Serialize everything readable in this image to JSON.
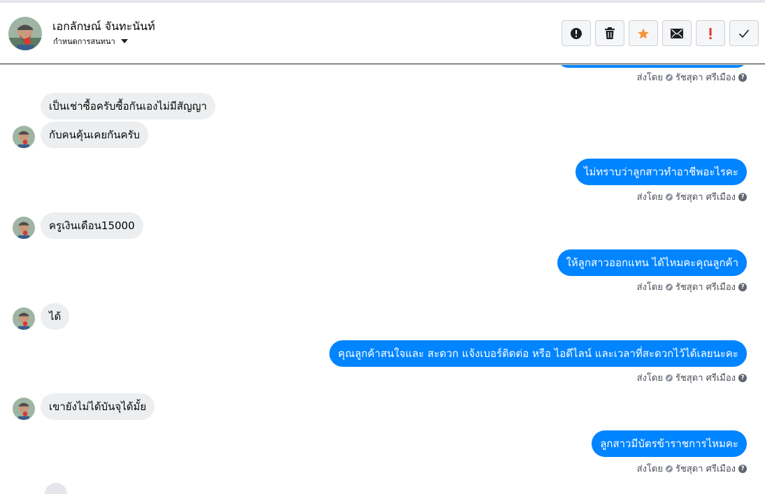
{
  "header": {
    "contact_name": "เอกลักษณ์ จันทะนันท์",
    "thread_setting_label": "กำหนดการสนทนา",
    "toolbar": [
      {
        "name": "report-button",
        "icon": "alert-circle-icon"
      },
      {
        "name": "delete-button",
        "icon": "trash-icon"
      },
      {
        "name": "star-button",
        "icon": "star-icon"
      },
      {
        "name": "mail-button",
        "icon": "envelope-icon"
      },
      {
        "name": "important-button",
        "icon": "exclamation-icon"
      },
      {
        "name": "done-button",
        "icon": "checkmark-icon"
      }
    ]
  },
  "sent_by": {
    "prefix": "ส่งโดย",
    "agent": "รัชสุดา ศรีเมือง"
  },
  "messages": [
    {
      "direction": "in",
      "text": "เป็นเช่าซื้อครับซื้อกันเองไม่มีสัญญา"
    },
    {
      "direction": "in",
      "text": "กับคนคุ้นเคยกันครับ"
    },
    {
      "direction": "out",
      "text": "ไม่ทราบว่าลูกสาวทำอาชีพอะไรคะ"
    },
    {
      "direction": "in",
      "text": "ครูเงินเดือน15000"
    },
    {
      "direction": "out",
      "text": "ให้ลูกสาวออกแทน ได้ไหมคะคุณลูกค้า"
    },
    {
      "direction": "in",
      "text": "ได้"
    },
    {
      "direction": "out",
      "text": "คุณลูกค้าสนใจและ สะดวก แจ้งเบอร์ติดต่อ หรือ ไอดีไลน์ และเวลาที่สะดวกไว้ได้เลยนะคะ"
    },
    {
      "direction": "in",
      "text": "เขายังไม่ได้บันจุได้มั้ย"
    },
    {
      "direction": "out",
      "text": "ลูกสาวมีบัตรข้าราชการไหมคะ"
    }
  ],
  "colors": {
    "outgoing_bubble": "#0084ff",
    "incoming_bubble": "#eceef0",
    "star": "#f7923a",
    "important": "#e4312b"
  }
}
